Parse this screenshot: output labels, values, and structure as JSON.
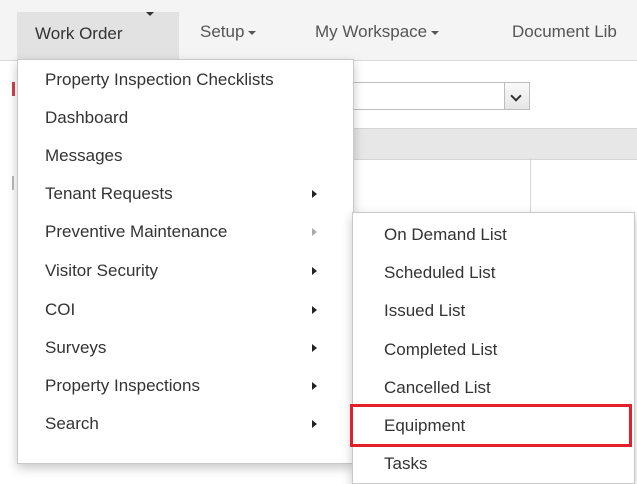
{
  "navbar": {
    "items": [
      {
        "label": "Work Order",
        "active": true
      },
      {
        "label": "Setup"
      },
      {
        "label": "My Workspace"
      },
      {
        "label": "Document Lib"
      }
    ]
  },
  "menu": {
    "items": [
      {
        "label": "Property Inspection Checklists",
        "submenu": false
      },
      {
        "label": "Dashboard",
        "submenu": false
      },
      {
        "label": "Messages",
        "submenu": false
      },
      {
        "label": "Tenant Requests",
        "submenu": true
      },
      {
        "label": "Preventive Maintenance",
        "submenu": true,
        "open": true
      },
      {
        "label": "Visitor Security",
        "submenu": true
      },
      {
        "label": "COI",
        "submenu": true
      },
      {
        "label": "Surveys",
        "submenu": true
      },
      {
        "label": "Property Inspections",
        "submenu": true
      },
      {
        "label": "Search",
        "submenu": true
      }
    ]
  },
  "submenu": {
    "items": [
      {
        "label": "On Demand List"
      },
      {
        "label": "Scheduled List"
      },
      {
        "label": "Issued List"
      },
      {
        "label": "Completed List"
      },
      {
        "label": "Cancelled List"
      },
      {
        "label": "Equipment",
        "highlighted": true
      },
      {
        "label": "Tasks"
      }
    ]
  },
  "colors": {
    "highlight_border": "#e0202a",
    "navbar_bg": "#f4f4f4",
    "active_nav_bg": "#e2e2e2"
  }
}
